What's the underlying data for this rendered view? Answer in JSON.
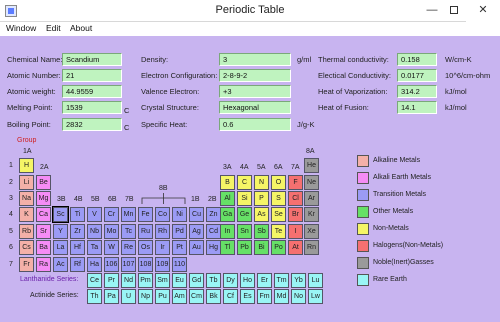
{
  "window": {
    "title": "Periodic Table",
    "min": "—",
    "close": "✕"
  },
  "menu": [
    "Window",
    "Edit",
    "About"
  ],
  "details": {
    "fields": [
      {
        "label": "Chemical Name:",
        "value": "Scandium",
        "unit": ""
      },
      {
        "label": "Atomic Number:",
        "value": "21",
        "unit": ""
      },
      {
        "label": "Atomic weight:",
        "value": "44.9559",
        "unit": ""
      },
      {
        "label": "Melting Point:",
        "value": "1539",
        "unit": "C"
      },
      {
        "label": "Boiling Point:",
        "value": "2832",
        "unit": "C"
      },
      {
        "label": "Density:",
        "value": "3",
        "unit": "g/ml"
      },
      {
        "label": "Electron Configuration:",
        "value": "2-8-9-2",
        "unit": ""
      },
      {
        "label": "Valence Electron:",
        "value": "+3",
        "unit": ""
      },
      {
        "label": "Crystal Structure:",
        "value": "Hexagonal",
        "unit": ""
      },
      {
        "label": "Specific Heat:",
        "value": "0.6",
        "unit": "J/g-K"
      },
      {
        "label": "Thermal conductivity:",
        "value": "0.158",
        "unit": "W/cm-K"
      },
      {
        "label": "Electical Conductivity:",
        "value": "0.0177",
        "unit": "10^6/cm-ohm"
      },
      {
        "label": "Heat of Vaporization:",
        "value": "314.2",
        "unit": "kJ/mol"
      },
      {
        "label": "Heat of Fusion:",
        "value": "14.1",
        "unit": "kJ/mol"
      }
    ]
  },
  "table": {
    "group_title": "Group",
    "group_labels": [
      "1A",
      "2A",
      "3B",
      "4B",
      "5B",
      "6B",
      "7B",
      "8B",
      "1B",
      "2B",
      "3A",
      "4A",
      "5A",
      "6A",
      "7A",
      "8A"
    ],
    "periods": [
      "1",
      "2",
      "3",
      "4",
      "5",
      "6",
      "7"
    ],
    "lanthanide_label": "Lanthanide Series:",
    "actinide_label": "Actinide Series:",
    "selected": "Sc",
    "colors": {
      "alkali": "#f4b0a8",
      "alkaline_earth": "#f58cf5",
      "transition": "#9b9bf5",
      "other_metal": "#66e066",
      "nonmetal": "#f5f566",
      "halogen": "#f57070",
      "noble": "#9a9a9a",
      "rare_earth": "#99f5f5"
    },
    "main_rows": [
      [
        "H",
        "",
        "",
        "",
        "",
        "",
        "",
        "",
        "",
        "",
        "",
        "",
        "",
        "",
        "",
        "",
        "",
        "He"
      ],
      [
        "Li",
        "Be",
        "",
        "",
        "",
        "",
        "",
        "",
        "",
        "",
        "",
        "",
        "B",
        "C",
        "N",
        "O",
        "F",
        "Ne"
      ],
      [
        "Na",
        "Mg",
        "",
        "",
        "",
        "",
        "",
        "",
        "",
        "",
        "",
        "",
        "Al",
        "Si",
        "P",
        "S",
        "Cl",
        "Ar"
      ],
      [
        "K",
        "Ca",
        "Sc",
        "Ti",
        "V",
        "Cr",
        "Mn",
        "Fe",
        "Co",
        "Ni",
        "Cu",
        "Zn",
        "Ga",
        "Ge",
        "As",
        "Se",
        "Br",
        "Kr"
      ],
      [
        "Rb",
        "Sr",
        "Y",
        "Zr",
        "Nb",
        "Mo",
        "Tc",
        "Ru",
        "Rh",
        "Pd",
        "Ag",
        "Cd",
        "In",
        "Sn",
        "Sb",
        "Te",
        "I",
        "Xe"
      ],
      [
        "Cs",
        "Ba",
        "La",
        "Hf",
        "Ta",
        "W",
        "Re",
        "Os",
        "Ir",
        "Pt",
        "Au",
        "Hg",
        "Tl",
        "Pb",
        "Bi",
        "Po",
        "At",
        "Rn"
      ],
      [
        "Fr",
        "Ra",
        "Ac",
        "Rf",
        "Ha",
        "106",
        "107",
        "108",
        "109",
        "110",
        "",
        "",
        "",
        "",
        "",
        "",
        "",
        ""
      ]
    ],
    "main_types": [
      [
        "nonmetal",
        "",
        "",
        "",
        "",
        "",
        "",
        "",
        "",
        "",
        "",
        "",
        "",
        "",
        "",
        "",
        "",
        "noble"
      ],
      [
        "alkali",
        "alkaline_earth",
        "",
        "",
        "",
        "",
        "",
        "",
        "",
        "",
        "",
        "",
        "nonmetal",
        "nonmetal",
        "nonmetal",
        "nonmetal",
        "halogen",
        "noble"
      ],
      [
        "alkali",
        "alkaline_earth",
        "",
        "",
        "",
        "",
        "",
        "",
        "",
        "",
        "",
        "",
        "other_metal",
        "nonmetal",
        "nonmetal",
        "nonmetal",
        "halogen",
        "noble"
      ],
      [
        "alkali",
        "alkaline_earth",
        "transition",
        "transition",
        "transition",
        "transition",
        "transition",
        "transition",
        "transition",
        "transition",
        "transition",
        "transition",
        "other_metal",
        "other_metal",
        "nonmetal",
        "nonmetal",
        "halogen",
        "noble"
      ],
      [
        "alkali",
        "alkaline_earth",
        "transition",
        "transition",
        "transition",
        "transition",
        "transition",
        "transition",
        "transition",
        "transition",
        "transition",
        "transition",
        "other_metal",
        "other_metal",
        "other_metal",
        "nonmetal",
        "halogen",
        "noble"
      ],
      [
        "alkali",
        "alkaline_earth",
        "transition",
        "transition",
        "transition",
        "transition",
        "transition",
        "transition",
        "transition",
        "transition",
        "transition",
        "transition",
        "other_metal",
        "other_metal",
        "other_metal",
        "other_metal",
        "halogen",
        "noble"
      ],
      [
        "alkali",
        "alkaline_earth",
        "transition",
        "transition",
        "transition",
        "transition",
        "transition",
        "transition",
        "transition",
        "transition",
        "",
        "",
        "",
        "",
        "",
        "",
        "",
        ""
      ]
    ],
    "lanthanides": [
      "Ce",
      "Pr",
      "Nd",
      "Pm",
      "Sm",
      "Eu",
      "Gd",
      "Tb",
      "Dy",
      "Ho",
      "Er",
      "Tm",
      "Yb",
      "Lu"
    ],
    "actinides": [
      "Th",
      "Pa",
      "U",
      "Np",
      "Pu",
      "Am",
      "Cm",
      "Bk",
      "Cf",
      "Es",
      "Fm",
      "Md",
      "No",
      "Lw"
    ]
  },
  "legend": [
    {
      "label": "Alkaline Metals",
      "type": "alkali"
    },
    {
      "label": "Alkali Earth Metals",
      "type": "alkaline_earth"
    },
    {
      "label": "Transition Metals",
      "type": "transition"
    },
    {
      "label": "Other Metals",
      "type": "other_metal"
    },
    {
      "label": "Non-Metals",
      "type": "nonmetal"
    },
    {
      "label": "Halogens(Non-Metals)",
      "type": "halogen"
    },
    {
      "label": "Noble(Inert)Gasses",
      "type": "noble"
    },
    {
      "label": "Rare Earth",
      "type": "rare_earth"
    }
  ]
}
